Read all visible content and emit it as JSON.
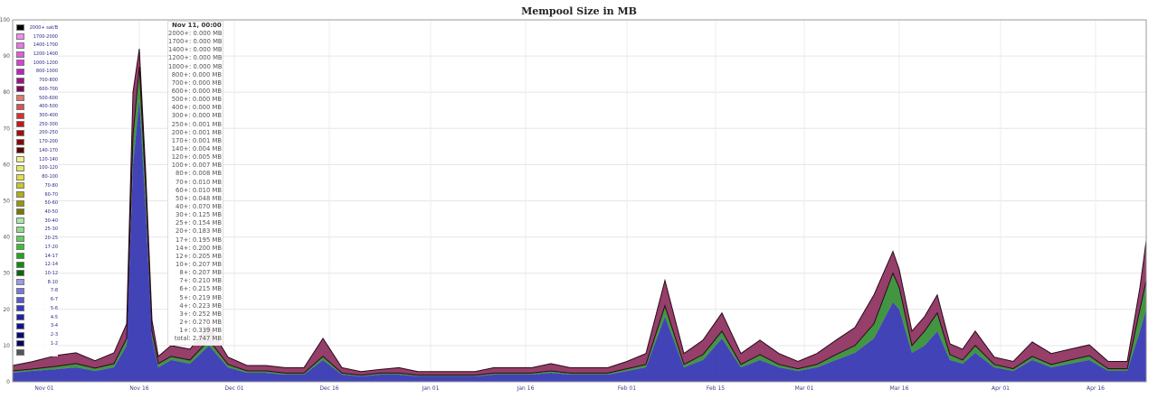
{
  "chart_data": {
    "type": "area",
    "title": "Mempool Size in MB",
    "xlabel": "",
    "ylabel": "",
    "ylim": [
      0,
      100
    ],
    "yticks": [
      0,
      10,
      20,
      30,
      40,
      50,
      60,
      70,
      80,
      90,
      100
    ],
    "x_tick_labels": [
      "Nov 01",
      "Nov 16",
      "Dec 01",
      "Dec 16",
      "Jan 01",
      "Jan 16",
      "Feb 01",
      "Feb 15",
      "Mar 01",
      "Mar 16",
      "Apr 01",
      "Apr 16"
    ],
    "grid": true,
    "legend_position": "top-left",
    "x": [
      "Oct 27",
      "Oct 30",
      "Nov 03",
      "Nov 06",
      "Nov 09",
      "Nov 12",
      "Nov 14",
      "Nov 15",
      "Nov 16",
      "Nov 17",
      "Nov 18",
      "Nov 19",
      "Nov 21",
      "Nov 24",
      "Nov 27",
      "Nov 30",
      "Dec 03",
      "Dec 06",
      "Dec 09",
      "Dec 12",
      "Dec 15",
      "Dec 18",
      "Dec 21",
      "Dec 24",
      "Dec 27",
      "Dec 30",
      "Jan 02",
      "Jan 05",
      "Jan 08",
      "Jan 11",
      "Jan 14",
      "Jan 17",
      "Jan 20",
      "Jan 23",
      "Jan 26",
      "Jan 29",
      "Feb 01",
      "Feb 04",
      "Feb 07",
      "Feb 10",
      "Feb 13",
      "Feb 16",
      "Feb 19",
      "Feb 22",
      "Feb 25",
      "Feb 28",
      "Mar 03",
      "Mar 06",
      "Mar 09",
      "Mar 12",
      "Mar 15",
      "Mar 16",
      "Mar 18",
      "Mar 20",
      "Mar 22",
      "Mar 24",
      "Mar 26",
      "Mar 28",
      "Mar 31",
      "Apr 03",
      "Apr 06",
      "Apr 09",
      "Apr 12",
      "Apr 15",
      "Apr 18",
      "Apr 21",
      "Apr 23",
      "Apr 24"
    ],
    "series": [
      {
        "name": "1-2",
        "color": "#2f2fb0",
        "values": [
          2.5,
          3,
          3.5,
          4,
          3,
          4,
          10,
          60,
          78,
          48,
          12,
          4,
          6,
          5,
          10,
          4,
          2.5,
          2.5,
          2,
          2,
          6,
          2,
          1.5,
          2,
          2,
          1.5,
          1.5,
          1.5,
          1.5,
          2,
          2,
          2,
          2.5,
          2,
          2,
          2,
          3,
          4,
          18,
          4,
          6,
          12,
          4,
          6,
          4,
          3,
          4,
          6,
          8,
          12,
          22,
          20,
          8,
          10,
          14,
          6,
          5,
          8,
          4,
          3,
          6,
          4,
          5,
          6,
          3,
          3,
          14,
          20
        ]
      },
      {
        "name": "10-12",
        "color": "#2e8b2e",
        "values": [
          0.5,
          0.5,
          0.8,
          1,
          0.8,
          1,
          2,
          8,
          9,
          6,
          2,
          1,
          1,
          1,
          1.5,
          0.8,
          0.5,
          0.5,
          0.4,
          0.4,
          1,
          0.4,
          0.3,
          0.4,
          0.4,
          0.3,
          0.3,
          0.3,
          0.3,
          0.4,
          0.4,
          0.4,
          0.5,
          0.4,
          0.4,
          0.4,
          0.6,
          0.8,
          3,
          0.8,
          1.5,
          2,
          0.8,
          1.5,
          0.8,
          0.6,
          0.8,
          1.5,
          2,
          4,
          8,
          6,
          2,
          4,
          5,
          1.5,
          1,
          2,
          0.8,
          0.6,
          1,
          0.8,
          1,
          1.2,
          0.6,
          0.6,
          6,
          8
        ]
      },
      {
        "name": "30-40",
        "color": "#8a2a5a",
        "values": [
          1.5,
          2,
          3,
          3,
          2,
          3,
          4,
          12,
          5,
          4,
          3,
          2,
          3,
          3,
          4,
          2,
          1.5,
          1.5,
          1.5,
          1.5,
          5,
          1.5,
          1,
          1,
          1.5,
          1,
          1,
          1,
          1,
          1.5,
          1.5,
          1.5,
          2,
          1.5,
          1.5,
          1.5,
          2,
          3,
          7,
          3,
          4,
          5,
          3,
          4,
          3,
          2,
          3,
          4,
          5,
          8,
          6,
          5,
          4,
          4,
          5,
          3,
          3,
          4,
          2,
          2,
          4,
          3,
          3,
          3,
          2,
          2,
          6,
          11
        ]
      }
    ]
  },
  "legend": [
    {
      "label": "2000+ sat/B",
      "color": "#000000"
    },
    {
      "label": "1700-2000",
      "color": "#f08ef0"
    },
    {
      "label": "1400-1700",
      "color": "#e878e8"
    },
    {
      "label": "1200-1400",
      "color": "#e05ce0"
    },
    {
      "label": "1000-1200",
      "color": "#d840d8"
    },
    {
      "label": "800-1000",
      "color": "#c020c0"
    },
    {
      "label": "700-800",
      "color": "#a0108a"
    },
    {
      "label": "600-700",
      "color": "#800060"
    },
    {
      "label": "500-600",
      "color": "#e07a6a"
    },
    {
      "label": "400-500",
      "color": "#e05050"
    },
    {
      "label": "300-400",
      "color": "#d83030"
    },
    {
      "label": "250-300",
      "color": "#c81818"
    },
    {
      "label": "200-250",
      "color": "#a80c0c"
    },
    {
      "label": "170-200",
      "color": "#880808"
    },
    {
      "label": "140-170",
      "color": "#600404"
    },
    {
      "label": "120-140",
      "color": "#f0f08a"
    },
    {
      "label": "100-120",
      "color": "#e8e860"
    },
    {
      "label": "80-100",
      "color": "#e0e040"
    },
    {
      "label": "70-80",
      "color": "#c8c828"
    },
    {
      "label": "60-70",
      "color": "#b0b018"
    },
    {
      "label": "50-60",
      "color": "#98980c"
    },
    {
      "label": "40-50",
      "color": "#787806"
    },
    {
      "label": "30-40",
      "color": "#a8e8a8"
    },
    {
      "label": "25-30",
      "color": "#88e088"
    },
    {
      "label": "20-25",
      "color": "#60d060"
    },
    {
      "label": "17-20",
      "color": "#38c038"
    },
    {
      "label": "14-17",
      "color": "#20a820"
    },
    {
      "label": "12-14",
      "color": "#108c10"
    },
    {
      "label": "10-12",
      "color": "#086808"
    },
    {
      "label": "8-10",
      "color": "#9a9ae8"
    },
    {
      "label": "7-8",
      "color": "#7878e0"
    },
    {
      "label": "6-7",
      "color": "#5858d8"
    },
    {
      "label": "5-6",
      "color": "#3838c8"
    },
    {
      "label": "4-5",
      "color": "#2020b0"
    },
    {
      "label": "3-4",
      "color": "#101098"
    },
    {
      "label": "2-3",
      "color": "#080880"
    },
    {
      "label": "1-2",
      "color": "#040460"
    },
    {
      "label": "",
      "color": "#555555"
    }
  ],
  "tooltip": {
    "title": "Nov 11, 00:00",
    "rows": [
      {
        "k": "2000+",
        "v": "0.000 MB"
      },
      {
        "k": "1700+",
        "v": "0.000 MB"
      },
      {
        "k": "1400+",
        "v": "0.000 MB"
      },
      {
        "k": "1200+",
        "v": "0.000 MB"
      },
      {
        "k": "1000+",
        "v": "0.000 MB"
      },
      {
        "k": "800+",
        "v": "0.000 MB"
      },
      {
        "k": "700+",
        "v": "0.000 MB"
      },
      {
        "k": "600+",
        "v": "0.000 MB"
      },
      {
        "k": "500+",
        "v": "0.000 MB"
      },
      {
        "k": "400+",
        "v": "0.000 MB"
      },
      {
        "k": "300+",
        "v": "0.000 MB"
      },
      {
        "k": "250+",
        "v": "0.001 MB"
      },
      {
        "k": "200+",
        "v": "0.001 MB"
      },
      {
        "k": "170+",
        "v": "0.001 MB"
      },
      {
        "k": "140+",
        "v": "0.004 MB"
      },
      {
        "k": "120+",
        "v": "0.005 MB"
      },
      {
        "k": "100+",
        "v": "0.007 MB"
      },
      {
        "k": "80+",
        "v": "0.008 MB"
      },
      {
        "k": "70+",
        "v": "0.010 MB"
      },
      {
        "k": "60+",
        "v": "0.010 MB"
      },
      {
        "k": "50+",
        "v": "0.048 MB"
      },
      {
        "k": "40+",
        "v": "0.070 MB"
      },
      {
        "k": "30+",
        "v": "0.125 MB"
      },
      {
        "k": "25+",
        "v": "0.154 MB"
      },
      {
        "k": "20+",
        "v": "0.183 MB"
      },
      {
        "k": "17+",
        "v": "0.195 MB"
      },
      {
        "k": "14+",
        "v": "0.200 MB"
      },
      {
        "k": "12+",
        "v": "0.205 MB"
      },
      {
        "k": "10+",
        "v": "0.207 MB"
      },
      {
        "k": "8+",
        "v": "0.207 MB"
      },
      {
        "k": "7+",
        "v": "0.210 MB"
      },
      {
        "k": "6+",
        "v": "0.215 MB"
      },
      {
        "k": "5+",
        "v": "0.219 MB"
      },
      {
        "k": "4+",
        "v": "0.223 MB"
      },
      {
        "k": "3+",
        "v": "0.252 MB"
      },
      {
        "k": "2+",
        "v": "0.270 MB"
      },
      {
        "k": "1+",
        "v": "0.339 MB"
      },
      {
        "k": "total",
        "v": "2.747 MB"
      }
    ]
  }
}
